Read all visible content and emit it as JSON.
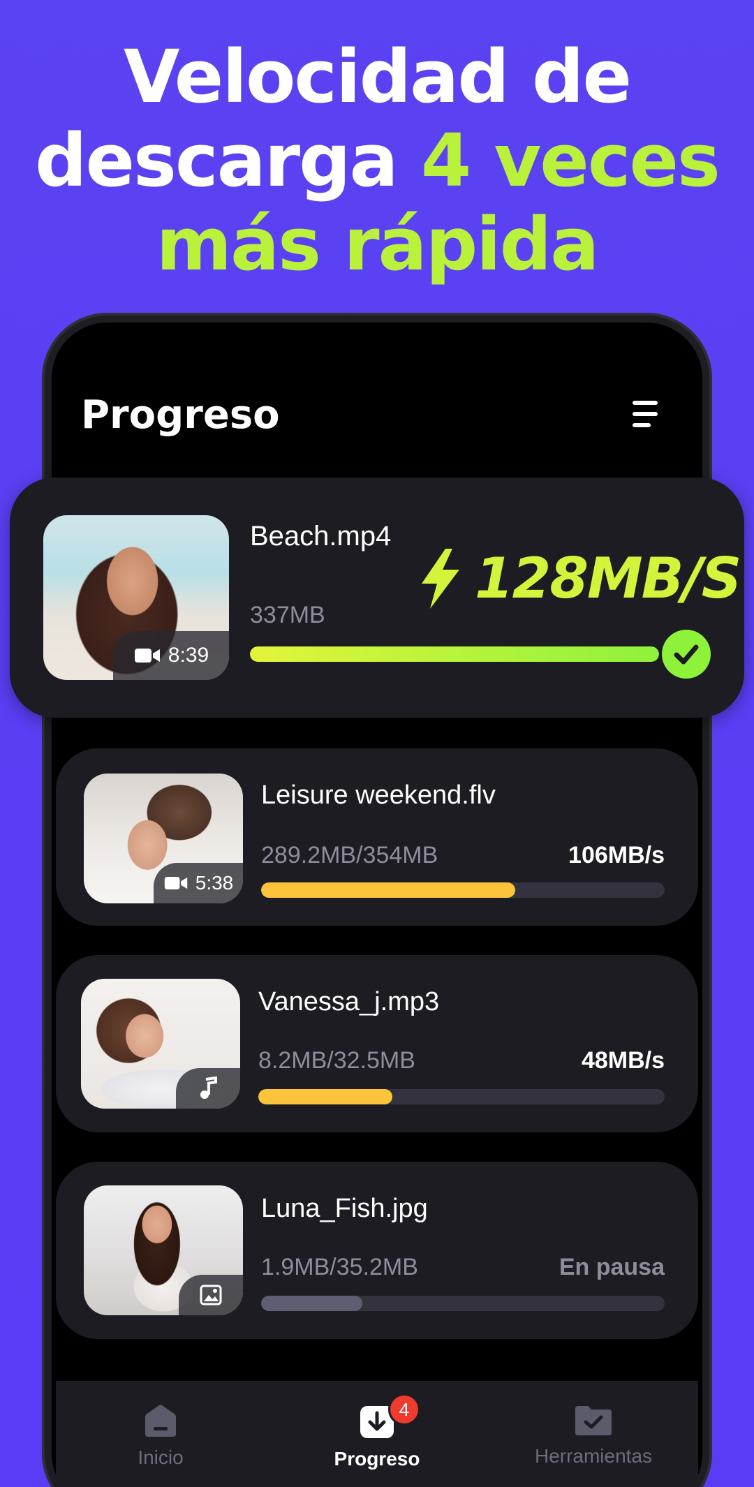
{
  "headline": {
    "line1": "Velocidad de",
    "line2_white": "descarga ",
    "line2_accent": "4 veces",
    "line3_accent": "más rápida"
  },
  "screen": {
    "title": "Progreso"
  },
  "featured": {
    "filename": "Beach.mp4",
    "size": "337MB",
    "duration": "8:39",
    "speed": "128MB/S",
    "progress": 1.0
  },
  "downloads": [
    {
      "filename": "Leisure weekend.flv",
      "progress_text": "289.2MB/354MB",
      "speed": "106MB/s",
      "duration": "5:38",
      "type_icon": "video-icon",
      "progress": 0.63,
      "bar_color": "#fcc43a"
    },
    {
      "filename": "Vanessa_j.mp3",
      "progress_text": "8.2MB/32.5MB",
      "speed": "48MB/s",
      "type_icon": "music-note-icon",
      "progress": 0.33,
      "bar_color": "#fcc43a"
    },
    {
      "filename": "Luna_Fish.jpg",
      "progress_text": "1.9MB/35.2MB",
      "speed": "En pausa",
      "type_icon": "image-icon",
      "progress": 0.25,
      "bar_color": "#5f5d72"
    }
  ],
  "nav": {
    "items": [
      {
        "label": "Inicio",
        "icon": "home-icon"
      },
      {
        "label": "Progreso",
        "icon": "download-icon",
        "badge": "4"
      },
      {
        "label": "Herramientas",
        "icon": "folder-check-icon"
      }
    ]
  },
  "colors": {
    "background": "#5a43f2",
    "accent_green": "#b9f13b",
    "progress_yellow": "#fcc43a",
    "paused_gray": "#5f5d72",
    "badge_red": "#ef3b2d"
  }
}
